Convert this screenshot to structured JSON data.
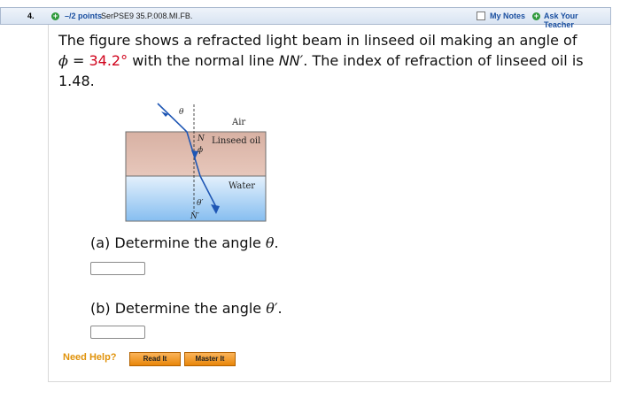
{
  "header": {
    "question_number": "4.",
    "points": "–/2 points",
    "source_ref": "SerPSE9 35.P.008.MI.FB.",
    "my_notes": "My Notes",
    "ask_teacher": "Ask Your Teacher"
  },
  "question": {
    "text_1": "The figure shows a refracted light beam in linseed oil making an angle of ",
    "phi_symbol": "ϕ",
    "text_2": " = ",
    "angle_value": "34.2°",
    "text_3": " with the normal line ",
    "normal_line": "NN′",
    "text_4": ". The index of refraction of linseed oil is 1.48."
  },
  "figure": {
    "label_theta": "θ",
    "label_air": "Air",
    "label_n": "N",
    "label_linseed": "Linseed oil",
    "label_phi": "ϕ",
    "label_water": "Water",
    "label_theta_prime": "θ′",
    "label_n_prime": "N′"
  },
  "part_a": {
    "prefix": "(a) Determine the angle ",
    "symbol": "θ",
    "suffix": ".",
    "value": ""
  },
  "part_b": {
    "prefix": "(b) Determine the angle ",
    "symbol": "θ′",
    "suffix": ".",
    "value": ""
  },
  "help": {
    "label": "Need Help?",
    "read_it": "Read It",
    "master_it": "Master It"
  },
  "colors": {
    "points_text": "#1a4fa0",
    "angle_value": "#d0021b",
    "oil_layer": "#ddb9ad",
    "water_layer": "#8fc3ef",
    "light_beam": "#1e56b4",
    "help_button": "#f0a23a"
  }
}
